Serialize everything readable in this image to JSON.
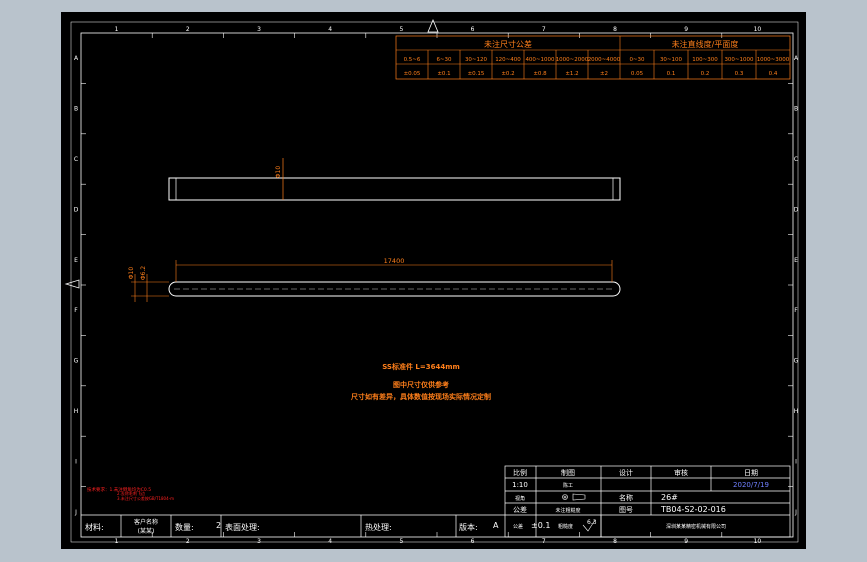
{
  "frame": {
    "top_ruler": [
      "1",
      "2",
      "3",
      "4",
      "5",
      "6",
      "7",
      "8",
      "9",
      "10"
    ],
    "bottom_ruler": [
      "1",
      "2",
      "3",
      "4",
      "5",
      "6",
      "7",
      "8",
      "9",
      "10"
    ],
    "left_ruler": [
      "A",
      "B",
      "C",
      "D",
      "E",
      "F",
      "G",
      "H",
      "I",
      "J"
    ],
    "right_ruler": [
      "A",
      "B",
      "C",
      "D",
      "E",
      "F",
      "G",
      "H",
      "I",
      "J"
    ]
  },
  "tolerance_table": {
    "left_header": "未注尺寸公差",
    "right_header": "未注直线度/平面度",
    "left_ranges": [
      "0.5~6",
      "6~30",
      "30~120",
      "120~400",
      "400~1000",
      "1000~2000",
      "2000~4000"
    ],
    "left_values": [
      "±0.05",
      "±0.1",
      "±0.15",
      "±0.2",
      "±0.8",
      "±1.2",
      "±2"
    ],
    "right_ranges": [
      "0~30",
      "30~100",
      "100~300",
      "300~1000",
      "1000~3000"
    ],
    "right_values": [
      "0.05",
      "0.1",
      "0.2",
      "0.3",
      "0.4"
    ]
  },
  "drawing": {
    "dim_diameter": "Φ10",
    "dim_length": "17400",
    "dim_left_a": "Φ10",
    "dim_left_b": "Φ6.2"
  },
  "notes": {
    "line1": "SS标准件 L=3644mm",
    "line2": "图中尺寸仅供参考",
    "line3": "尺寸如有差异，具体数值按现场实际情况定制"
  },
  "red_notes": {
    "line1": "技术要求：1.未注倒角均为C0.5",
    "line2": "2.去除毛刺飞边",
    "line3": "3.未注尺寸公差按GB/T1804-m"
  },
  "title_block": {
    "scale_label": "比例",
    "scale_value": "1:10",
    "drawn_label": "制图",
    "drawn_value": "陈工",
    "design_label": "设计",
    "check_label": "审核",
    "date_label": "日期",
    "date_value": "2020/7/19",
    "projection_label": "视角",
    "name_label": "名称",
    "name_value": "26#",
    "drawing_no_label": "图号",
    "drawing_no_value": "TB04-S2-02-016",
    "tolerance_label": "公差",
    "tolerance_value": "±0.1",
    "roughness_label": "粗糙度",
    "roughness_value": "6.3",
    "general_label": "未注粗糙度",
    "company": "深圳某某精密机械有限公司",
    "material_label": "材料:",
    "material_value": "",
    "qty_label": "数量:",
    "qty_value": "2",
    "surface_label": "表面处理:",
    "surface_value": "",
    "heat_label": "热处理:",
    "heat_value": "",
    "version_label": "版本:",
    "version_value": "A",
    "customer_label": "客户名称",
    "customer_value": "(某某)"
  }
}
